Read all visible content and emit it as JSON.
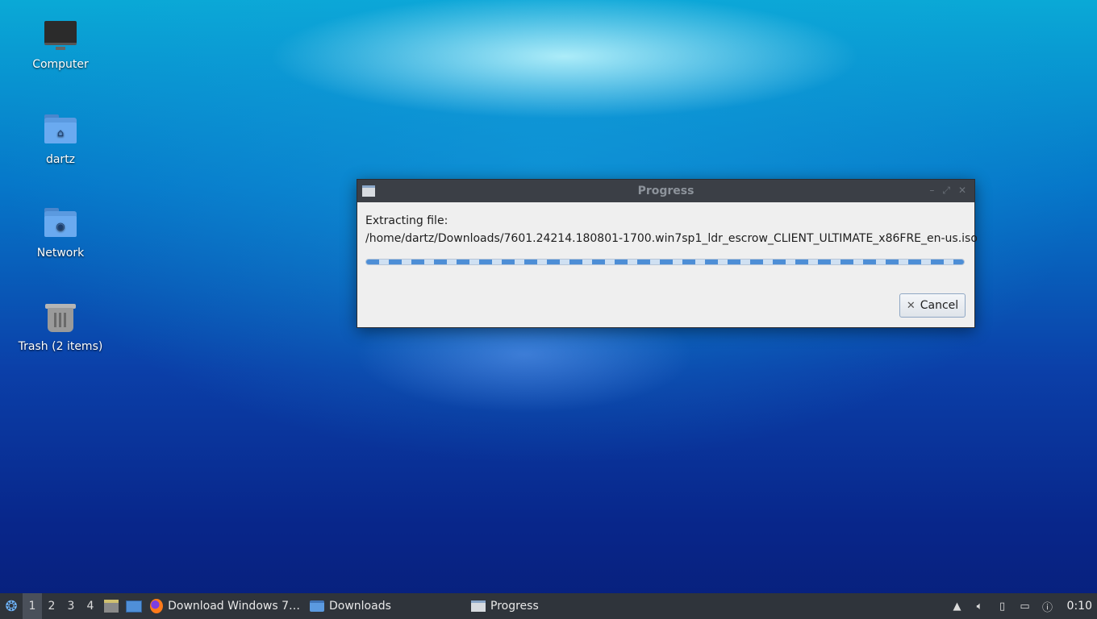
{
  "desktop": {
    "icons": [
      {
        "label": "Computer",
        "icon": "computer-icon"
      },
      {
        "label": "dartz",
        "icon": "home-folder-icon"
      },
      {
        "label": "Network",
        "icon": "network-folder-icon"
      },
      {
        "label": "Trash (2 items)",
        "icon": "trash-icon"
      }
    ]
  },
  "dialog": {
    "title": "Progress",
    "message": "Extracting file:",
    "file_path": "/home/dartz/Downloads/7601.24214.180801-1700.win7sp1_ldr_escrow_CLIENT_ULTIMATE_x86FRE_en-us.iso",
    "progress": "indeterminate",
    "cancel_label": "Cancel",
    "controls": {
      "minimize": "–",
      "maximize": "⤢",
      "close": "✕"
    }
  },
  "taskbar": {
    "workspaces": [
      "1",
      "2",
      "3",
      "4"
    ],
    "active_workspace": "1",
    "tasks": [
      {
        "label": "Download Windows 7…",
        "icon": "firefox-icon"
      },
      {
        "label": "Downloads",
        "icon": "folder-icon"
      },
      {
        "label": "Progress",
        "icon": "window-icon"
      }
    ],
    "clock": "0:10"
  },
  "colors": {
    "titlebar": "#3b3f46",
    "taskbar": "#2f343b",
    "progress_accent": "#4d8ed6"
  }
}
